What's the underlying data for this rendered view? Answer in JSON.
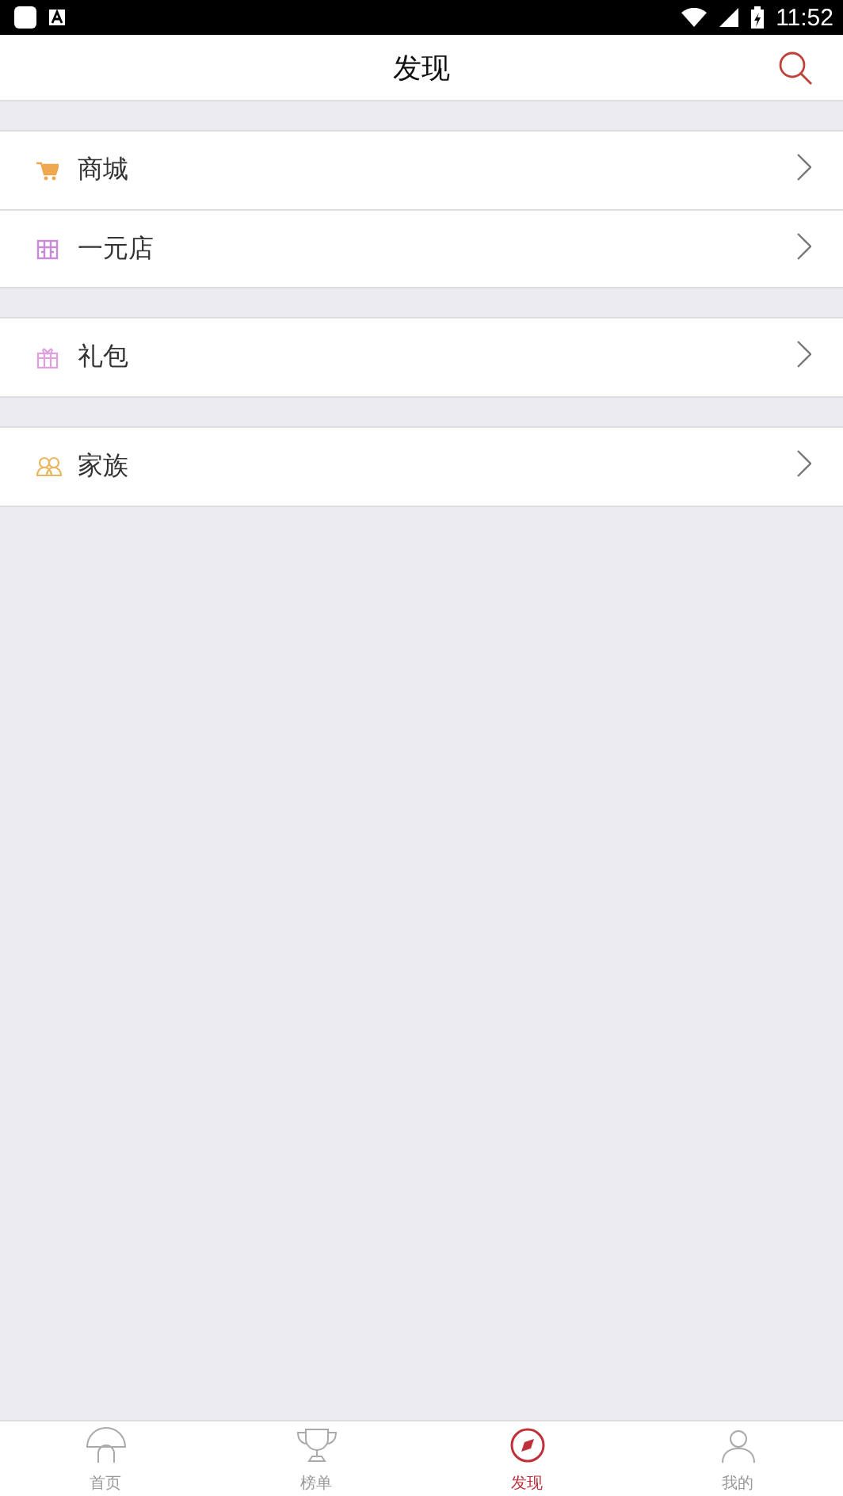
{
  "status_bar": {
    "time": "11:52"
  },
  "header": {
    "title": "发现"
  },
  "groups": [
    {
      "items": [
        {
          "label": "商城",
          "kind": "cart"
        },
        {
          "label": "一元店",
          "kind": "shop"
        }
      ]
    },
    {
      "items": [
        {
          "label": "礼包",
          "kind": "gift"
        }
      ]
    },
    {
      "items": [
        {
          "label": "家族",
          "kind": "family"
        }
      ]
    }
  ],
  "tabs": [
    {
      "label": "首页",
      "kind": "home",
      "selected": false
    },
    {
      "label": "榜单",
      "kind": "trophy",
      "selected": false
    },
    {
      "label": "发现",
      "kind": "discover",
      "selected": true
    },
    {
      "label": "我的",
      "kind": "me",
      "selected": false
    }
  ]
}
